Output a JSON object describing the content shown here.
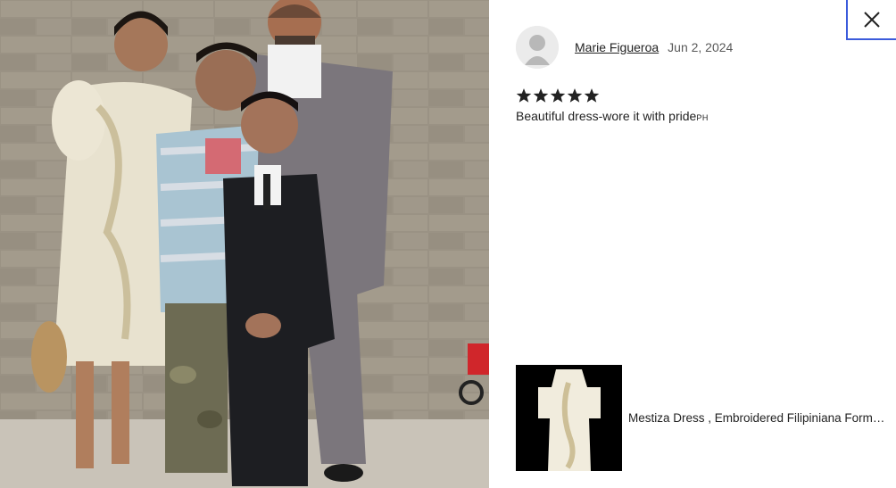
{
  "dialog": {
    "close_label": "Close"
  },
  "photo": {
    "icon": "review-photo",
    "description_icon": "family-photo-icon"
  },
  "review": {
    "reviewer_name": "Marie Figueroa",
    "date": "Jun 2, 2024",
    "rating": 5,
    "rating_max": 5,
    "text_main": "Beautiful dress-wore it with pride",
    "text_suffix": "PH"
  },
  "product": {
    "title": "Mestiza Dress , Embroidered Filipiniana Formal Dress"
  },
  "colors": {
    "focus_outline": "#3b5bdb",
    "star": "#222222",
    "text": "#222222",
    "muted_text": "#595959"
  }
}
